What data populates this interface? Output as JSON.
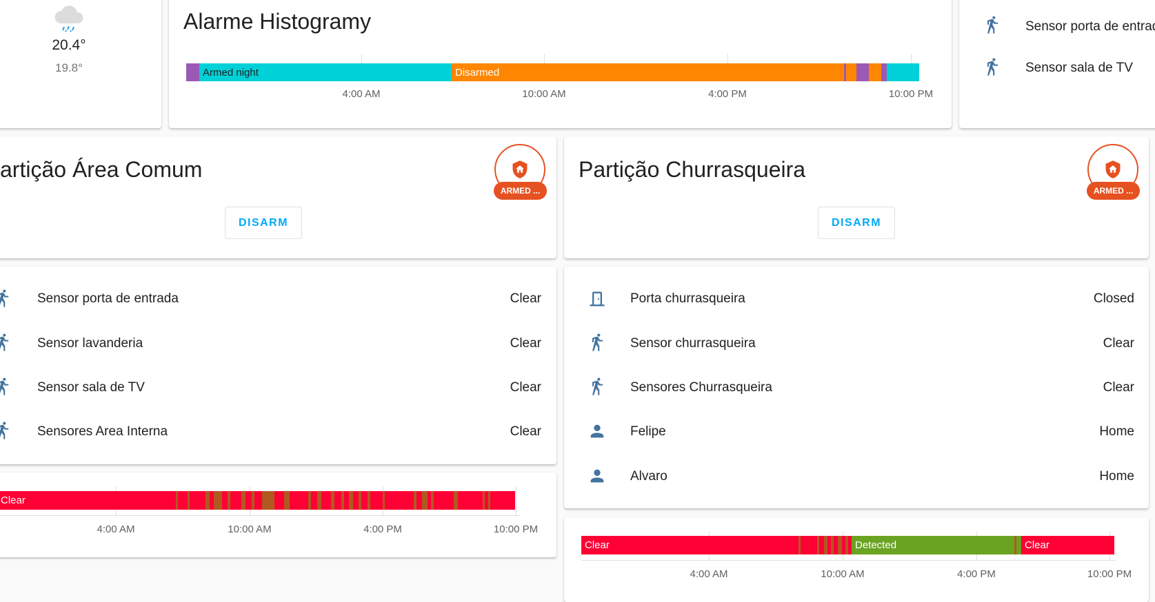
{
  "weather": {
    "icon": "rainy-cloud-icon",
    "temp_high": "20.4°",
    "temp_low": "19.8°"
  },
  "alarm_history": {
    "title": "Alarme Histogramy",
    "labels": {
      "armed_night": "Armed night",
      "disarmed": "Disarmed"
    },
    "ticks": [
      "4:00 AM",
      "10:00 AM",
      "4:00 PM",
      "10:00 PM"
    ]
  },
  "top_right": {
    "items": [
      {
        "name": "Sensor porta de entrad",
        "icon": "walk-icon"
      },
      {
        "name": "Sensor sala de TV",
        "icon": "walk-icon"
      }
    ]
  },
  "partition_area": {
    "title": "artição Área Comum",
    "badge": "ARMED ...",
    "disarm_label": "DISARM"
  },
  "partition_churras": {
    "title": "Partição Churrasqueira",
    "badge": "ARMED ...",
    "disarm_label": "DISARM"
  },
  "entities_left": [
    {
      "name": "Sensor porta de entrada",
      "state": "Clear",
      "icon": "walk-icon"
    },
    {
      "name": "Sensor lavanderia",
      "state": "Clear",
      "icon": "walk-icon"
    },
    {
      "name": "Sensor sala de TV",
      "state": "Clear",
      "icon": "walk-icon"
    },
    {
      "name": "Sensores Area Interna",
      "state": "Clear",
      "icon": "walk-icon"
    }
  ],
  "entities_right": [
    {
      "name": "Porta churrasqueira",
      "state": "Closed",
      "icon": "door-icon"
    },
    {
      "name": "Sensor churrasqueira",
      "state": "Clear",
      "icon": "walk-icon"
    },
    {
      "name": "Sensores Churrasqueira",
      "state": "Clear",
      "icon": "walk-icon"
    },
    {
      "name": "Felipe",
      "state": "Home",
      "icon": "person-icon"
    },
    {
      "name": "Alvaro",
      "state": "Home",
      "icon": "person-icon"
    }
  ],
  "history_left": {
    "label": "Clear",
    "ticks": [
      "4:00 AM",
      "10:00 AM",
      "4:00 PM",
      "10:00 PM"
    ]
  },
  "history_right": {
    "labels": {
      "clear1": "Clear",
      "detected": "Detected",
      "clear2": "Clear"
    },
    "ticks": [
      "4:00 AM",
      "10:00 AM",
      "4:00 PM",
      "10:00 PM"
    ]
  },
  "colors": {
    "armed_night": "#9b59b6",
    "armed": "#00d1d8",
    "disarmed": "#ff8600",
    "clear": "#ff0035",
    "detected": "#6aa321",
    "alarm_accent": "#e65121",
    "icon": "#44739e",
    "link": "#03a9f4"
  }
}
